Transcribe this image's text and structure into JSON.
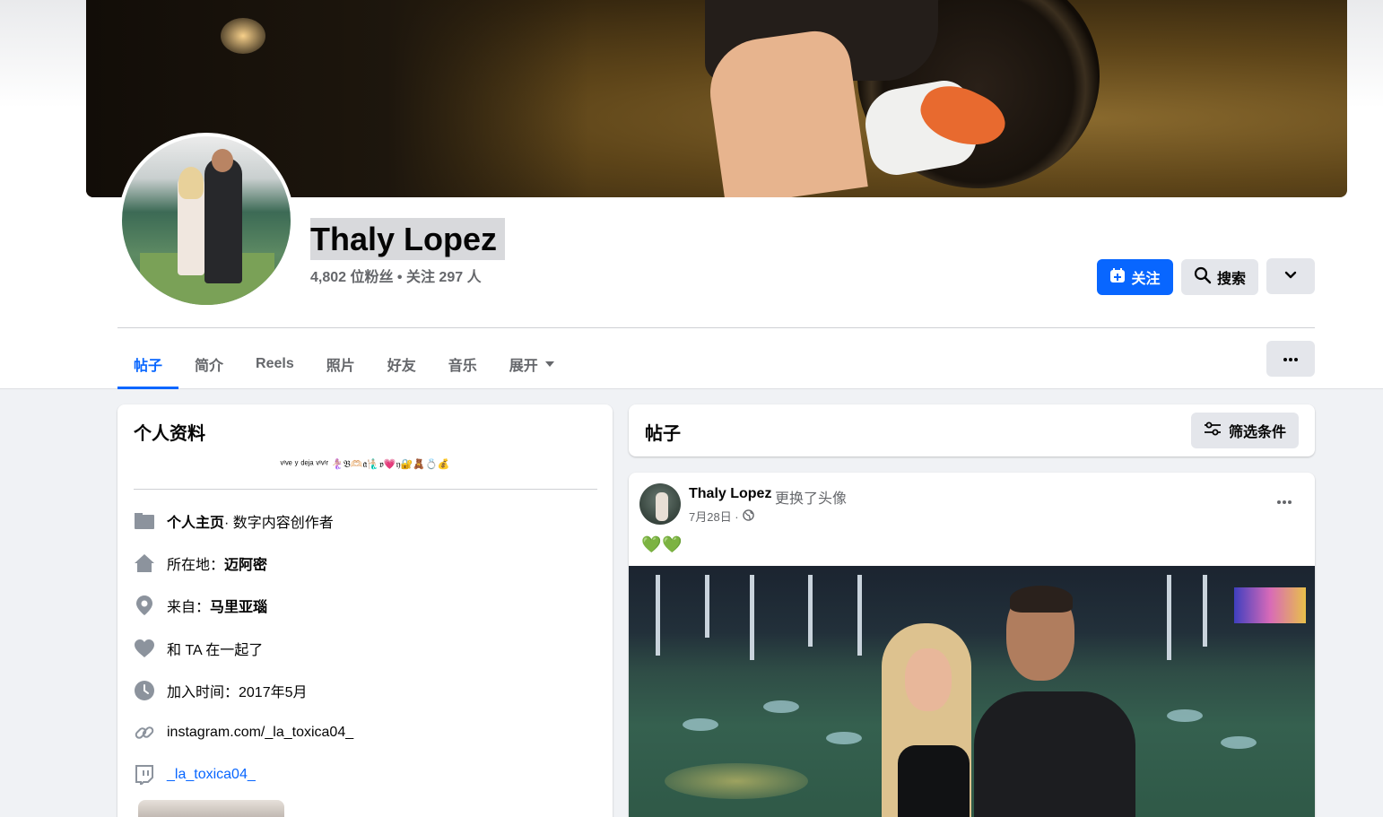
{
  "profile": {
    "name": "Thaly Lopez",
    "stats": "4,802 位粉丝 • 关注 297 人"
  },
  "actions": {
    "follow_label": "关注",
    "search_label": "搜索"
  },
  "tabs": [
    {
      "label": "帖子",
      "active": true
    },
    {
      "label": "简介"
    },
    {
      "label": "Reels"
    },
    {
      "label": "照片"
    },
    {
      "label": "好友"
    },
    {
      "label": "音乐"
    },
    {
      "label": "展开"
    }
  ],
  "intro": {
    "title": "个人资料",
    "bio": "ᵛⁱᵛᵉ ʸ ᵈᵉʲᵃ ᵛⁱᵛⁱʳ 🧜🏼‍♀️𝔅🫶🏻𝔞🧜🏼‍♂️𝔳💗𝔶🔐🧸💍💰",
    "page_prefix": "个人主页",
    "page_suffix": " · 数字内容创作者",
    "lives_prefix": "所在地：",
    "lives_value": "迈阿密",
    "from_prefix": "来自：",
    "from_value": "马里亚瑙",
    "relationship": "和 TA 在一起了",
    "joined": "加入时间：2017年5月",
    "instagram": "instagram.com/_la_toxica04_",
    "twitch": "_la_toxica04_"
  },
  "posts_section": {
    "title": "帖子",
    "filter_label": "筛选条件"
  },
  "post": {
    "author": "Thaly Lopez",
    "action": "更换了头像",
    "date": "7月28日 ·",
    "text": "💚💚"
  },
  "colors": {
    "accent": "#0866ff",
    "background": "#f0f2f5",
    "button_gray": "#e4e6eb",
    "secondary_text": "#65676b"
  }
}
